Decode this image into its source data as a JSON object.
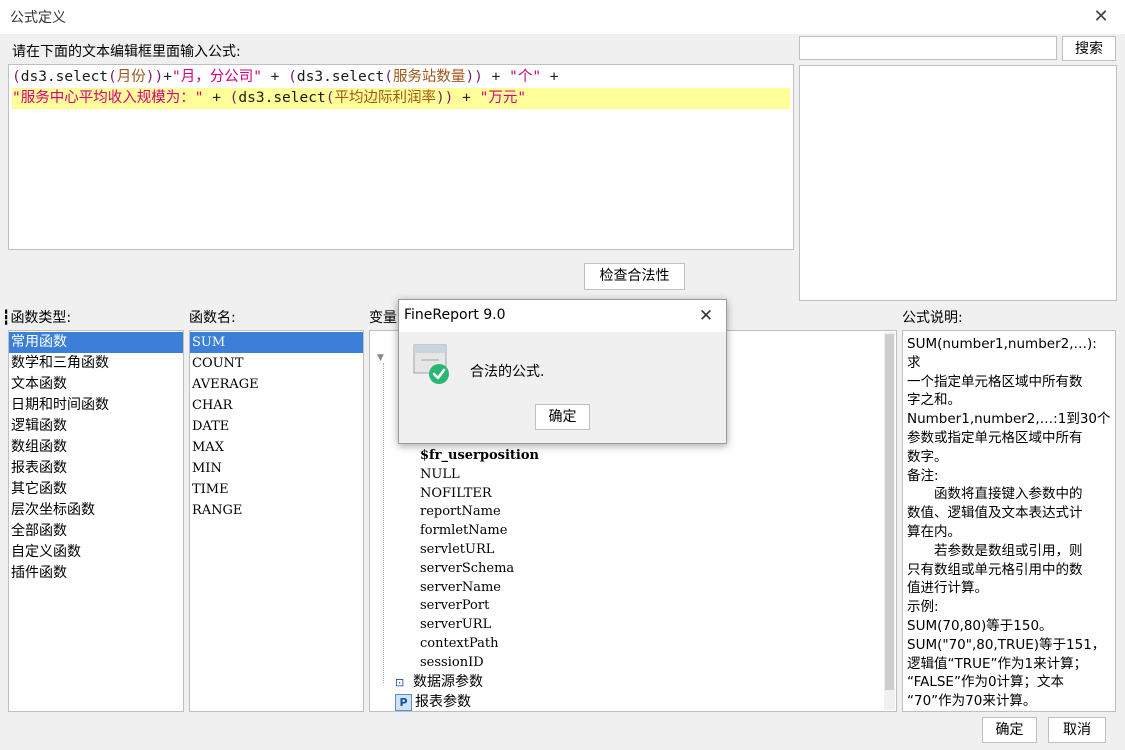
{
  "window": {
    "title": "公式定义"
  },
  "editor": {
    "prompt": "请在下面的文本编辑框里面输入公式:",
    "line1": [
      {
        "t": "(",
        "c": "paren"
      },
      {
        "t": "ds3.select",
        "c": "fn"
      },
      {
        "t": "(",
        "c": "paren"
      },
      {
        "t": "月份",
        "c": "field"
      },
      {
        "t": "))",
        "c": "paren"
      },
      {
        "t": "+",
        "c": "op"
      },
      {
        "t": "\"月，分公司\"",
        "c": "str"
      },
      {
        "t": " + ",
        "c": "op"
      },
      {
        "t": "(",
        "c": "paren"
      },
      {
        "t": "ds3.select",
        "c": "fn"
      },
      {
        "t": "(",
        "c": "paren"
      },
      {
        "t": "服务站数量",
        "c": "field"
      },
      {
        "t": "))",
        "c": "paren"
      },
      {
        "t": " + ",
        "c": "op"
      },
      {
        "t": "\"个\"",
        "c": "str"
      },
      {
        "t": " +",
        "c": "op"
      }
    ],
    "line2": [
      {
        "t": "\"服务中心平均收入规模为：\"",
        "c": "str"
      },
      {
        "t": " + ",
        "c": "op"
      },
      {
        "t": "(",
        "c": "paren"
      },
      {
        "t": "ds3.select",
        "c": "fn"
      },
      {
        "t": "(",
        "c": "paren"
      },
      {
        "t": "平均边际利润率",
        "c": "field"
      },
      {
        "t": "))",
        "c": "paren"
      },
      {
        "t": " + ",
        "c": "op"
      },
      {
        "t": "\"万元\"",
        "c": "str"
      }
    ],
    "check_button": "检查合法性"
  },
  "search": {
    "value": "",
    "button": "搜索"
  },
  "function_types": {
    "label": "函数类型:",
    "items": [
      "常用函数",
      "数学和三角函数",
      "文本函数",
      "日期和时间函数",
      "逻辑函数",
      "数组函数",
      "报表函数",
      "其它函数",
      "层次坐标函数",
      "全部函数",
      "自定义函数",
      "插件函数"
    ],
    "selected": 0
  },
  "function_names": {
    "label": "函数名:",
    "items": [
      "SUM",
      "COUNT",
      "AVERAGE",
      "CHAR",
      "DATE",
      "MAX",
      "MIN",
      "TIME",
      "RANGE"
    ],
    "selected": 0
  },
  "variables": {
    "label": "变量",
    "items": [
      "$fr_userposition",
      "NULL",
      "NOFILTER",
      "reportName",
      "formletName",
      "servletURL",
      "serverSchema",
      "serverName",
      "serverPort",
      "serverURL",
      "contextPath",
      "sessionID"
    ],
    "datasource_params": "数据源参数",
    "report_params": "报表参数"
  },
  "description": {
    "label": "公式说明:",
    "lines": [
      "SUM(number1,number2,…): 求",
      "一个指定单元格区域中所有数",
      "字之和。",
      "Number1,number2,…:1到30个",
      "参数或指定单元格区域中所有",
      "数字。",
      "备注:",
      "　　函数将直接键入参数中的",
      "数值、逻辑值及文本表达式计",
      "算在内。",
      "　　若参数是数组或引用，则",
      "只有数组或单元格引用中的数",
      "值进行计算。",
      "示例:",
      "SUM(70,80)等于150。",
      "SUM(\"70\",80,TRUE)等于151，",
      "逻辑值“TRUE”作为1来计算；",
      "“FALSE”作为0计算；文本",
      "“70”作为70来计算。"
    ]
  },
  "footer": {
    "ok": "确定",
    "cancel": "取消"
  },
  "dialog": {
    "title": "FineReport 9.0",
    "message": "合法的公式.",
    "ok": "确定"
  },
  "icons": {
    "close": "close-icon",
    "check": "check-circle-icon"
  },
  "colors": {
    "selection": "#3b7fd8",
    "highlight_line": "#ffff99",
    "string": "#d2007d",
    "field": "#a1561a",
    "success": "#2bb673"
  }
}
